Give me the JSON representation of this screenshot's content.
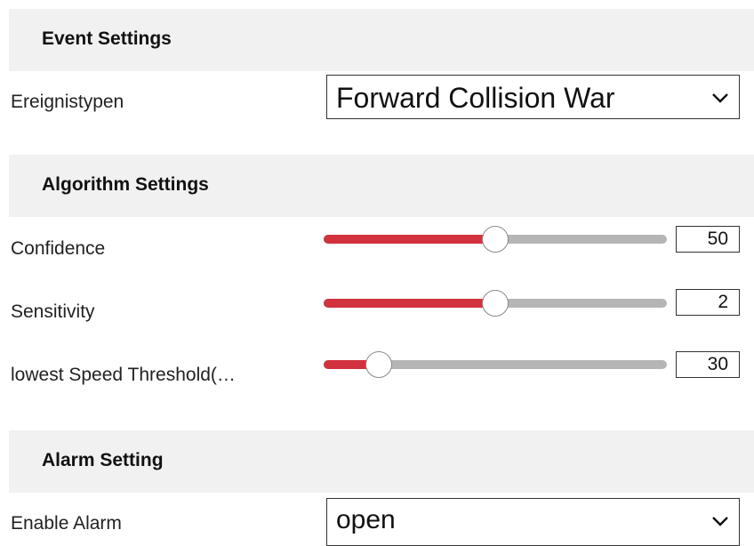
{
  "event_settings": {
    "title": "Event Settings",
    "event_types_label": "Ereignistypen",
    "event_types_value": "Forward Collision War"
  },
  "algorithm_settings": {
    "title": "Algorithm Settings",
    "sliders": [
      {
        "label": "Confidence",
        "value": "50",
        "fill_fraction": 0.5
      },
      {
        "label": "Sensitivity",
        "value": "2",
        "fill_fraction": 0.5
      },
      {
        "label": "lowest Speed Threshold(…",
        "value": "30",
        "fill_fraction": 0.16
      }
    ]
  },
  "alarm_setting": {
    "title": "Alarm Setting",
    "enable_alarm_label": "Enable Alarm",
    "enable_alarm_value": "open"
  },
  "colors": {
    "slider_fill": "#d1323e",
    "slider_track": "#b5b5b5",
    "header_bg": "#f1f1f1"
  },
  "icons": {
    "select_arrow": "chevron-down-icon"
  }
}
